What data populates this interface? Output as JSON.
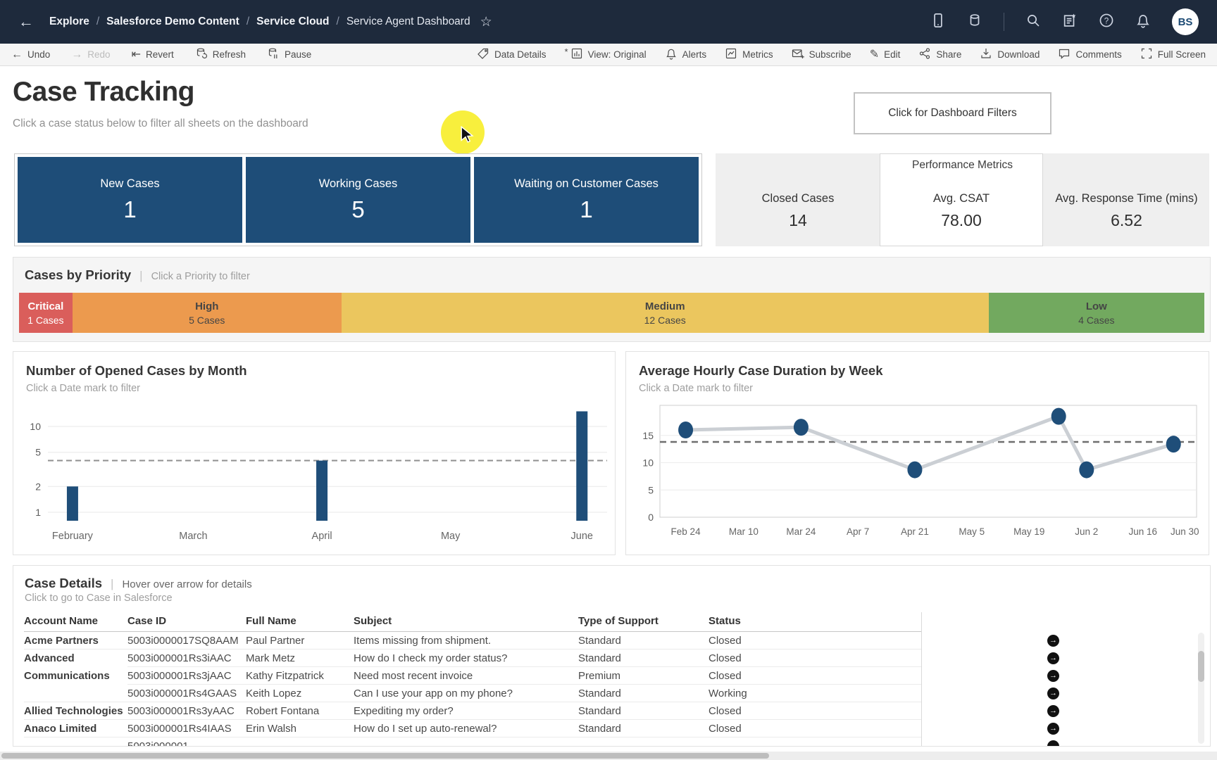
{
  "ui": {
    "divider": "|"
  },
  "topnav": {
    "breadcrumb": [
      "Explore",
      "Salesforce Demo Content",
      "Service Cloud",
      "Service Agent Dashboard"
    ],
    "avatar_initials": "BS"
  },
  "toolbar": {
    "left": [
      "Undo",
      "Redo",
      "Revert",
      "Refresh",
      "Pause"
    ],
    "right": [
      "Data Details",
      "View: Original",
      "Alerts",
      "Metrics",
      "Subscribe",
      "Edit",
      "Share",
      "Download",
      "Comments",
      "Full Screen"
    ]
  },
  "header": {
    "title": "Case Tracking",
    "subtitle": "Click a case status below to filter all sheets on the dashboard",
    "filters_button_label": "Click for Dashboard Filters"
  },
  "status_cards": [
    {
      "label": "New Cases",
      "value": "1"
    },
    {
      "label": "Working Cases",
      "value": "5"
    },
    {
      "label": "Waiting on Customer Cases",
      "value": "1"
    }
  ],
  "performance_metrics": {
    "title": "Performance Metrics",
    "metrics": [
      {
        "label": "Closed Cases",
        "value": "14"
      },
      {
        "label": "Avg. CSAT",
        "value": "78.00"
      },
      {
        "label": "Avg. Response Time (mins)",
        "value": "6.52"
      }
    ]
  },
  "cases_by_priority": {
    "title": "Cases by Priority",
    "hint": "Click a Priority to filter",
    "segments": [
      {
        "label": "Critical",
        "count": "1 Cases",
        "color": "#da5e5b",
        "text_color": "#ffffff",
        "width_pct": 4.5
      },
      {
        "label": "High",
        "count": "5 Cases",
        "color": "#ec9a4e",
        "text_color": "#454545",
        "width_pct": 22.7
      },
      {
        "label": "Medium",
        "count": "12 Cases",
        "color": "#ebc65e",
        "text_color": "#454545",
        "width_pct": 54.6
      },
      {
        "label": "Low",
        "count": "4 Cases",
        "color": "#72a95f",
        "text_color": "#454545",
        "width_pct": 18.2
      }
    ]
  },
  "chart_data": [
    {
      "type": "bar",
      "title": "Number of Opened Cases by Month",
      "subtitle": "Click a Date mark to filter",
      "y_scale": "log",
      "yticks": [
        1,
        2,
        5,
        10
      ],
      "categories": [
        "February",
        "March",
        "April",
        "May",
        "June"
      ],
      "values": [
        2,
        null,
        4,
        null,
        15
      ],
      "x_frac": [
        0.044,
        0.26,
        0.49,
        0.72,
        0.955
      ],
      "reference_line": 4,
      "bar_color": "#1f4e79",
      "grid": true
    },
    {
      "type": "line",
      "title": "Average Hourly Case Duration by Week",
      "subtitle": "Click a Date mark to filter",
      "yticks": [
        0,
        5,
        10,
        15
      ],
      "ylim": [
        0,
        20.5
      ],
      "x_tick_labels": [
        "Feb 24",
        "Mar 10",
        "Mar 24",
        "Apr 7",
        "Apr 21",
        "May 5",
        "May 19",
        "Jun 2",
        "Jun 16",
        "Jun 30"
      ],
      "x_tick_frac": [
        0.048,
        0.156,
        0.263,
        0.369,
        0.475,
        0.581,
        0.688,
        0.795,
        0.9,
        0.978
      ],
      "points": [
        {
          "week": "Feb 24",
          "value": 16.0,
          "x_frac": 0.048
        },
        {
          "week": "Mar 24",
          "value": 16.5,
          "x_frac": 0.263
        },
        {
          "week": "Apr 21",
          "value": 8.7,
          "x_frac": 0.475
        },
        {
          "week": "May 26",
          "value": 18.5,
          "x_frac": 0.743
        },
        {
          "week": "Jun 2",
          "value": 8.7,
          "x_frac": 0.795
        },
        {
          "week": "Jun 23",
          "value": 13.4,
          "x_frac": 0.957
        }
      ],
      "reference_line": 13.8,
      "point_color": "#1f4e79",
      "line_color": "#cbcfd4",
      "grid": true,
      "legend": "none"
    }
  ],
  "case_details": {
    "title": "Case Details",
    "hint": "Hover over arrow for details",
    "subtitle": "Click to go to Case in Salesforce",
    "columns": [
      "Account Name",
      "Case ID",
      "Full Name",
      "Subject",
      "Type of Support",
      "Status"
    ],
    "rows": [
      {
        "account": "Acme Partners",
        "case_id": "5003i0000017SQ8AAM",
        "full_name": "Paul Partner",
        "subject": "Items missing from shipment.",
        "type": "Standard",
        "status": "Closed",
        "account_sep": true
      },
      {
        "account": "Advanced",
        "case_id": "5003i000001Rs3iAAC",
        "full_name": "Mark Metz",
        "subject": "How do I check my order status?",
        "type": "Standard",
        "status": "Closed",
        "account_sep": false
      },
      {
        "account": "Communications",
        "case_id": "5003i000001Rs3jAAC",
        "full_name": "Kathy Fitzpatrick",
        "subject": "Need most recent invoice",
        "type": "Premium",
        "status": "Closed",
        "account_sep": false
      },
      {
        "account": "",
        "case_id": "5003i000001Rs4GAAS",
        "full_name": "Keith Lopez",
        "subject": "Can I use your app on my phone?",
        "type": "Standard",
        "status": "Working",
        "account_sep": true
      },
      {
        "account": "Allied Technologies",
        "case_id": "5003i000001Rs3yAAC",
        "full_name": "Robert Fontana",
        "subject": "Expediting my order?",
        "type": "Standard",
        "status": "Closed",
        "account_sep": true
      },
      {
        "account": "Anaco Limited",
        "case_id": "5003i000001Rs4IAAS",
        "full_name": "Erin Walsh",
        "subject": "How do I set up auto-renewal?",
        "type": "Standard",
        "status": "Closed",
        "account_sep": true
      },
      {
        "account": "",
        "case_id": "5003i000001...",
        "full_name": "",
        "subject": "",
        "type": "",
        "status": "",
        "account_sep": false,
        "partial": true
      }
    ]
  },
  "colors": {
    "accent_navy": "#1f4e79",
    "topnav_bg": "#1e2a3c",
    "highlight_yellow": "#f7ee2e"
  }
}
